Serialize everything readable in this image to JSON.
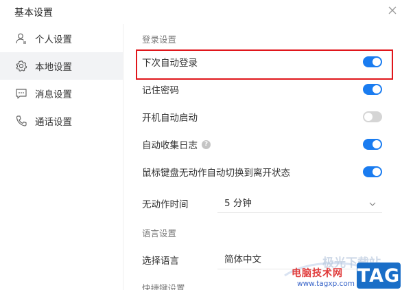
{
  "window": {
    "title": "基本设置"
  },
  "sidebar": {
    "items": [
      {
        "label": "个人设置",
        "icon": "user-icon",
        "active": false
      },
      {
        "label": "本地设置",
        "icon": "gear-icon",
        "active": true
      },
      {
        "label": "消息设置",
        "icon": "message-icon",
        "active": false
      },
      {
        "label": "通话设置",
        "icon": "phone-icon",
        "active": false
      }
    ]
  },
  "main": {
    "login_section": {
      "title": "登录设置",
      "options": [
        {
          "label": "下次自动登录",
          "enabled": true
        },
        {
          "label": "记住密码",
          "enabled": true
        },
        {
          "label": "开机自动启动",
          "enabled": false
        },
        {
          "label": "自动收集日志",
          "enabled": true,
          "help": "?"
        },
        {
          "label": "鼠标键盘无动作自动切换到离开状态",
          "enabled": true
        }
      ]
    },
    "idle_time": {
      "label": "无动作时间",
      "value": "5 分钟"
    },
    "language_section": {
      "title": "语言设置",
      "select_label": "选择语言",
      "value": "简体中文"
    },
    "shortcut_section": {
      "title": "快捷键设置"
    }
  },
  "watermark": {
    "site_name": "电脑技术网",
    "url": "www.tagxp.com",
    "tag": "TAG",
    "faint_text": "极光下载站"
  },
  "colors": {
    "accent": "#1a7cf0",
    "highlight_border": "#e0161b",
    "toggle_off": "#d5d5d5"
  }
}
